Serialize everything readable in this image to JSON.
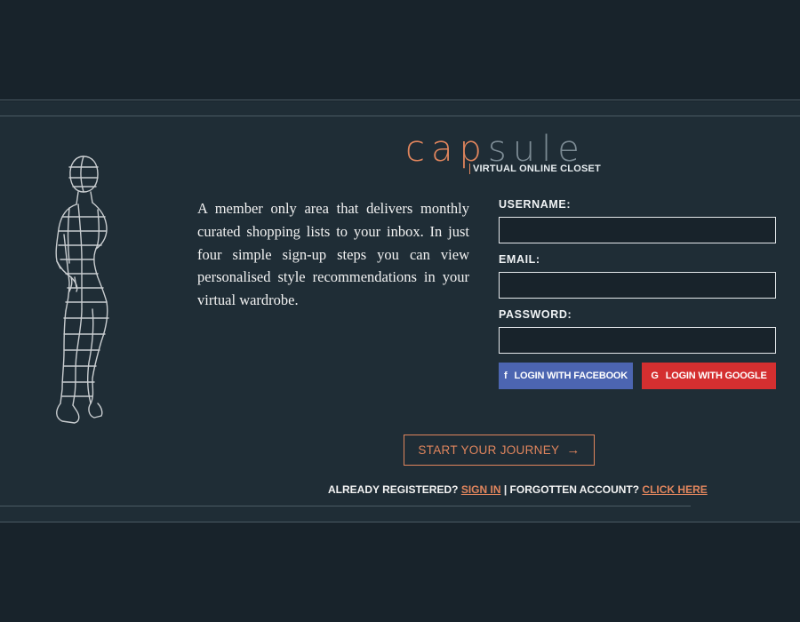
{
  "brand": {
    "logo_main": "cap",
    "logo_fade": "sule",
    "tagline": "VIRTUAL ONLINE CLOSET"
  },
  "intro": {
    "text": "A member only area that delivers monthly curated shopping lists to your inbox. In just four simple sign-up steps you can view personalised style recommendations in your virtual wardrobe."
  },
  "form": {
    "username_label": "USERNAME:",
    "username_value": "",
    "email_label": "EMAIL:",
    "email_value": "",
    "password_label": "PASSWORD:",
    "password_value": "",
    "facebook_label": "LOGIN WITH FACEBOOK",
    "facebook_icon": "f",
    "google_label": "LOGIN WITH GOOGLE",
    "google_icon": "G"
  },
  "cta": {
    "label": "START YOUR JOURNEY",
    "arrow": "→"
  },
  "footer": {
    "already_text": "ALREADY REGISTERED?",
    "sign_in_link": "SIGN IN",
    "separator": "|",
    "forgotten_text": "FORGOTTEN ACCOUNT?",
    "click_here_link": "CLICK HERE"
  },
  "colors": {
    "background": "#18232b",
    "panel": "#1f2d36",
    "accent": "#e0855d",
    "facebook": "#4c65b1",
    "google": "#d42f30"
  }
}
